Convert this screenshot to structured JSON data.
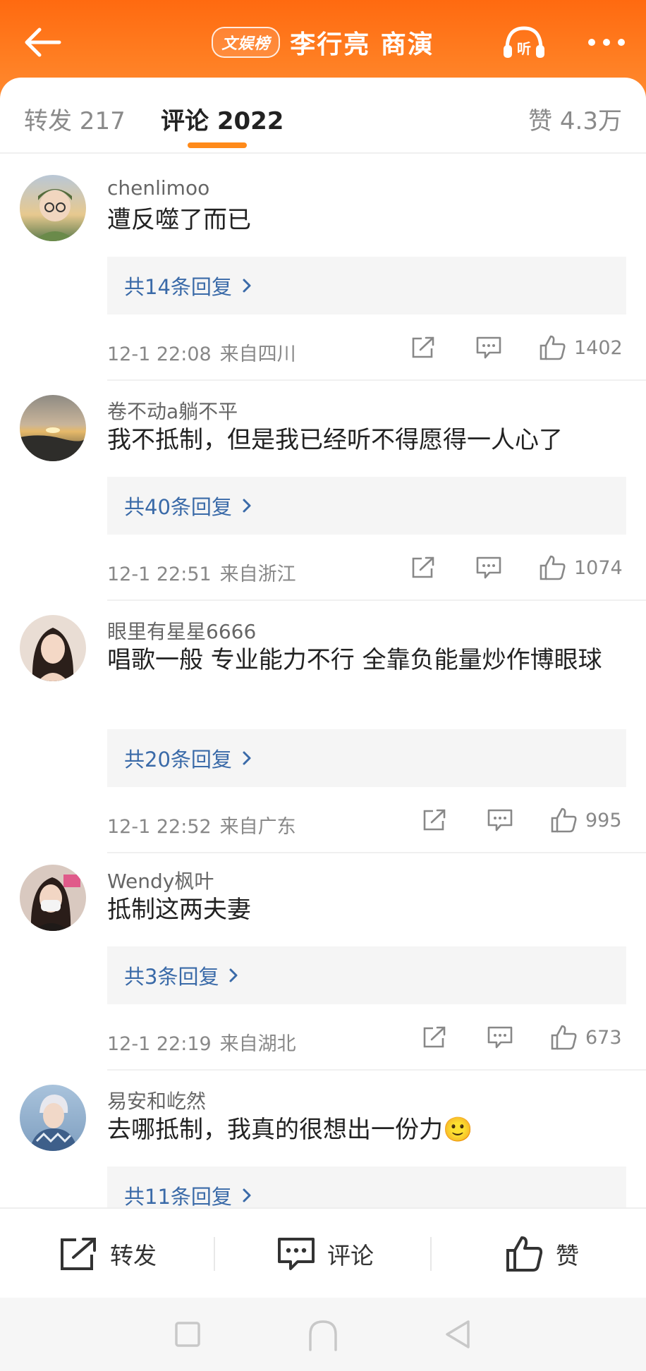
{
  "header": {
    "badge": "文娱榜",
    "title": "李行亮 商演",
    "listen_label": "听"
  },
  "tabs": {
    "repost": "转发 217",
    "comment": "评论 2022",
    "like": "赞 4.3万"
  },
  "comments": [
    {
      "username": "chenlimoo",
      "content": "遭反噬了而已",
      "replies": "共14条回复",
      "time": "12-1 22:08",
      "location": "来自四川",
      "likes": "1402"
    },
    {
      "username": "卷不动a躺不平",
      "content": "我不抵制，但是我已经听不得愿得一人心了",
      "replies": "共40条回复",
      "time": "12-1 22:51",
      "location": "来自浙江",
      "likes": "1074"
    },
    {
      "username": "眼里有星星6666",
      "content": "唱歌一般 专业能力不行 全靠负能量炒作博眼球",
      "replies": "共20条回复",
      "time": "12-1 22:52",
      "location": "来自广东",
      "likes": "995"
    },
    {
      "username": "Wendy枫叶",
      "content": "抵制这两夫妻",
      "replies": "共3条回复",
      "time": "12-1 22:19",
      "location": "来自湖北",
      "likes": "673"
    },
    {
      "username": "易安和屹然",
      "content": "去哪抵制，我真的很想出一份力🙂",
      "replies": "共11条回复"
    }
  ],
  "bottom_bar": {
    "repost": "转发",
    "comment": "评论",
    "like": "赞"
  },
  "colors": {
    "header_orange": "#ff7a1f",
    "accent_underline": "#ff8a1a",
    "reply_link": "#3a6aa8"
  }
}
